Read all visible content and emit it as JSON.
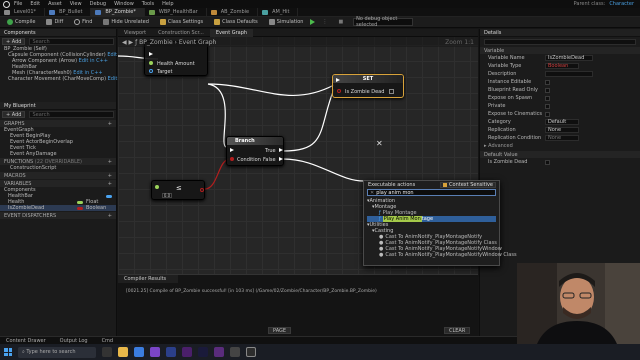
{
  "menubar": {
    "items": [
      "File",
      "Edit",
      "Asset",
      "View",
      "Debug",
      "Window",
      "Tools",
      "Help"
    ],
    "right_items": [
      "Parent class:",
      "Character"
    ]
  },
  "tabs": [
    {
      "label": "Level01*",
      "active": false
    },
    {
      "label": "BP_Bullet",
      "active": false
    },
    {
      "label": "BP_Zombie*",
      "active": true
    },
    {
      "label": "WBP_HealthBar",
      "active": false
    },
    {
      "label": "AB_Zombie",
      "active": false
    },
    {
      "label": "AM_Hit",
      "active": false
    }
  ],
  "toolbar": {
    "compile": "Compile",
    "diff": "Diff",
    "find": "Find",
    "hide_unrelated": "Hide Unrelated",
    "class_settings": "Class Settings",
    "class_defaults": "Class Defaults",
    "simulation": "Simulation",
    "debug_object": "No debug object selected"
  },
  "components": {
    "title": "Components",
    "add_label": "+ Add",
    "search_placeholder": "Search",
    "items": [
      "BP_Zombie (Self)",
      "Capsule Component (CollisionCylinder)",
      "Arrow Component (Arrow)",
      "HealthBar",
      "Mesh (CharacterMesh0)",
      "Character Movement (CharMoveComp)"
    ],
    "edit_in_cpp": "Edit in C++"
  },
  "my_blueprint": {
    "title": "My Blueprint",
    "add_label": "+ Add",
    "search_placeholder": "Search",
    "graphs_label": "GRAPHS",
    "event_graph": "EventGraph",
    "events": [
      "Event BeginPlay",
      "Event ActorBeginOverlap",
      "Event Tick",
      "Event AnyDamage"
    ],
    "functions_label": "FUNCTIONS",
    "functions_count": "(22 OVERRIDABLE)",
    "construction_script": "ConstructionScript",
    "macros_label": "MACROS",
    "variables_label": "VARIABLES",
    "components_label": "Components",
    "variables": [
      {
        "name": "HealthBar",
        "type": "",
        "color": "#4aa3f0"
      },
      {
        "name": "Health",
        "type": "Float",
        "color": "#9bd35a"
      },
      {
        "name": "IsZombieDead",
        "type": "Boolean",
        "color": "#b31e1e"
      }
    ],
    "dispatchers_label": "EVENT DISPATCHERS"
  },
  "graph": {
    "tabs": [
      "Viewport",
      "Construction Scr...",
      "Event Graph"
    ],
    "breadcrumb": [
      "BP_Zombie",
      "Event Graph"
    ],
    "zoom": "Zoom 1:1",
    "nodes": {
      "get_node_pins": [
        "Health Amount",
        "Target"
      ],
      "set_title": "SET",
      "set_pin": "Is Zombie Dead",
      "branch_title": "Branch",
      "branch_condition": "Condition",
      "branch_true": "True",
      "branch_false": "False",
      "compare_value": "0.0"
    }
  },
  "actions_menu": {
    "title": "Executable actions",
    "context_sensitive": "Context Sensitive",
    "query": "play anim mon",
    "categories": [
      {
        "label": "Animation",
        "subcats": [
          {
            "label": "Montage",
            "items": [
              "Play Montage",
              "Play Anim Montage"
            ]
          }
        ]
      },
      {
        "label": "Utilities",
        "subcats": [
          {
            "label": "Casting",
            "items": [
              "Cast To AnimNotify_PlayMontageNotify",
              "Cast To AnimNotify_PlayMontageNotify Class",
              "Cast To AnimNotify_PlayMontageNotifyWindow",
              "Cast To AnimNotify_PlayMontageNotifyWindow Class"
            ]
          }
        ]
      }
    ],
    "selected_item": "Play Anim Montage",
    "highlight_prefix": "Play Anim Mon",
    "highlight_suffix": "tage"
  },
  "details": {
    "title": "Details",
    "variable_section": "Variable",
    "rows": [
      {
        "label": "Variable Name",
        "value": "IsZombieDead",
        "kind": "text"
      },
      {
        "label": "Variable Type",
        "value": "Boolean",
        "kind": "text"
      },
      {
        "label": "Description",
        "value": "",
        "kind": "text"
      },
      {
        "label": "Instance Editable",
        "value": "",
        "kind": "check"
      },
      {
        "label": "Blueprint Read Only",
        "value": "",
        "kind": "check"
      },
      {
        "label": "Expose on Spawn",
        "value": "",
        "kind": "check"
      },
      {
        "label": "Private",
        "value": "",
        "kind": "check"
      },
      {
        "label": "Expose to Cinematics",
        "value": "",
        "kind": "check"
      },
      {
        "label": "Category",
        "value": "Default",
        "kind": "text"
      },
      {
        "label": "Replication",
        "value": "None",
        "kind": "text"
      },
      {
        "label": "Replication Condition",
        "value": "None",
        "kind": "text"
      }
    ],
    "advanced": "Advanced",
    "default_value_section": "Default Value",
    "default_value_label": "Is Zombie Dead"
  },
  "compiler": {
    "title": "Compiler Results",
    "message": "[0021.25] Compile of BP_Zombie successful! [in 103 ms] (/Game/02/Zombie/Character/BP_Zombie.BP_Zombie)",
    "page_label": "PAGE",
    "clear_label": "CLEAR"
  },
  "status": {
    "items": [
      "Content Drawer",
      "Output Log",
      "Cmd"
    ]
  },
  "taskbar": {
    "search_placeholder": "Type here to search"
  }
}
